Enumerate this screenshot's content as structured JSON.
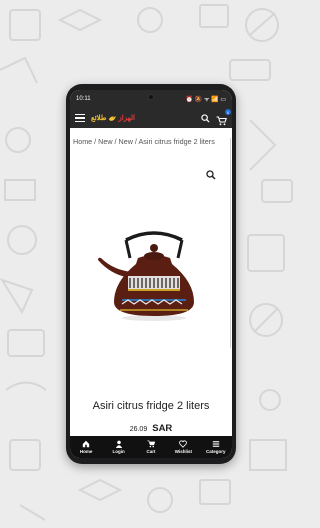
{
  "status_bar": {
    "time": "10:11",
    "indicators": "⏰ 🔕 ᯤ 📶 ▭"
  },
  "app_bar": {
    "logo_text_1": "طلائع",
    "logo_text_2": "الهزاز",
    "menu_icon": "hamburger-icon",
    "search_icon": "search-icon",
    "cart_icon": "cart-icon",
    "cart_count": "0"
  },
  "breadcrumb": "Home / New / New / Asiri citrus fridge 2 liters",
  "product": {
    "title": "Asiri citrus fridge 2 liters",
    "price_amount": "26.09",
    "price_currency": "SAR",
    "image": "enamel-teapot-brown-patterned"
  },
  "bottom_nav": [
    {
      "label": "Home",
      "icon": "home-icon"
    },
    {
      "label": "Login",
      "icon": "user-icon"
    },
    {
      "label": "Cart",
      "icon": "cart-icon"
    },
    {
      "label": "Wishlist",
      "icon": "heart-icon"
    },
    {
      "label": "Category",
      "icon": "list-icon"
    }
  ],
  "colors": {
    "bar": "#2a2a2a",
    "nav": "#111111",
    "logo_yellow": "#f2c230",
    "logo_red": "#e23b3b",
    "badge": "#1e6fd9"
  }
}
